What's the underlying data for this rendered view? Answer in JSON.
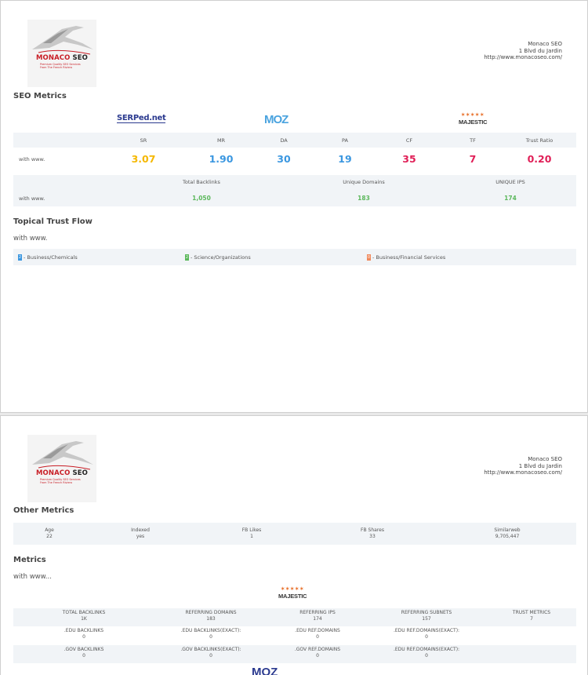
{
  "logo": {
    "name_part1": "MONACO",
    "name_part2": "SEO",
    "tagline_line1": "Premium Quality SEO Services",
    "tagline_line2": "From The French Riviera"
  },
  "address": {
    "company": "Monaco SEO",
    "street": "1 Blvd du Jardin",
    "url": "http://www.monacoseo.com/"
  },
  "seo_metrics": {
    "title": "SEO Metrics",
    "brands": {
      "serped": "SERPed.net",
      "moz": "MOZ",
      "majestic": "MAJESTIC",
      "majestic_stars": "✶✶✶✶✶"
    },
    "headers": [
      "SR",
      "MR",
      "DA",
      "PA",
      "CF",
      "TF",
      "Trust Ratio"
    ],
    "row_label": "with www.",
    "values": [
      "3.07",
      "1.90",
      "30",
      "19",
      "35",
      "7",
      "0.20"
    ],
    "value_colors": [
      "#f5b800",
      "#3b97e0",
      "#3b97e0",
      "#3b97e0",
      "#e01f57",
      "#e01f57",
      "#e01f57"
    ],
    "backlinks_headers": [
      "Total Backlinks",
      "Unique Domains",
      "UNIQUE IPS"
    ],
    "backlinks_row_label": "with www.",
    "backlinks_values": [
      "1,050",
      "183",
      "174"
    ]
  },
  "topical": {
    "title": "Topical Trust Flow",
    "note": "with www.",
    "items": [
      {
        "num": "2",
        "label": " - Business/Chemicals",
        "color": "#3b97e0"
      },
      {
        "num": "2",
        "label": " - Science/Organizations",
        "color": "#5cb85c"
      },
      {
        "num": "0",
        "label": " - Business/Financial Services",
        "color": "#f08a5d"
      }
    ]
  },
  "other_metrics": {
    "title": "Other Metrics",
    "items": [
      {
        "label": "Age",
        "value": "22"
      },
      {
        "label": "Indexed",
        "value": "yes"
      },
      {
        "label": "FB Likes",
        "value": "1"
      },
      {
        "label": "FB Shares",
        "value": "33"
      },
      {
        "label": "Similarweb",
        "value": "9,705,447"
      }
    ]
  },
  "metrics": {
    "title": "Metrics",
    "note": "with www...",
    "brand": "MAJESTIC",
    "brand_stars": "✶✶✶✶✶",
    "rows": [
      [
        {
          "label": "TOTAL BACKLINKS",
          "value": "1K"
        },
        {
          "label": "REFERRING DOMAINS",
          "value": "183"
        },
        {
          "label": "REFERRING IPS",
          "value": "174"
        },
        {
          "label": "REFERRING SUBNETS",
          "value": "157"
        },
        {
          "label": "TRUST METRICS",
          "value": "7"
        }
      ],
      [
        {
          "label": ".EDU BACKLINKS",
          "value": "0"
        },
        {
          "label": ".EDU BACKLINKS(EXACT):",
          "value": "0"
        },
        {
          "label": ".EDU REF.DOMAINS",
          "value": "0"
        },
        {
          "label": ".EDU REF.DOMAINS(EXACT):",
          "value": "0"
        }
      ],
      [
        {
          "label": ".GOV BACKLINKS",
          "value": "0"
        },
        {
          "label": ".GOV BACKLINKS(EXACT):",
          "value": "0"
        },
        {
          "label": ".GOV REF.DOMAINS",
          "value": "0"
        },
        {
          "label": ".EDU REF.DOMAINS(EXACT):",
          "value": "0"
        }
      ]
    ],
    "bottom_brand": "MOZ"
  }
}
